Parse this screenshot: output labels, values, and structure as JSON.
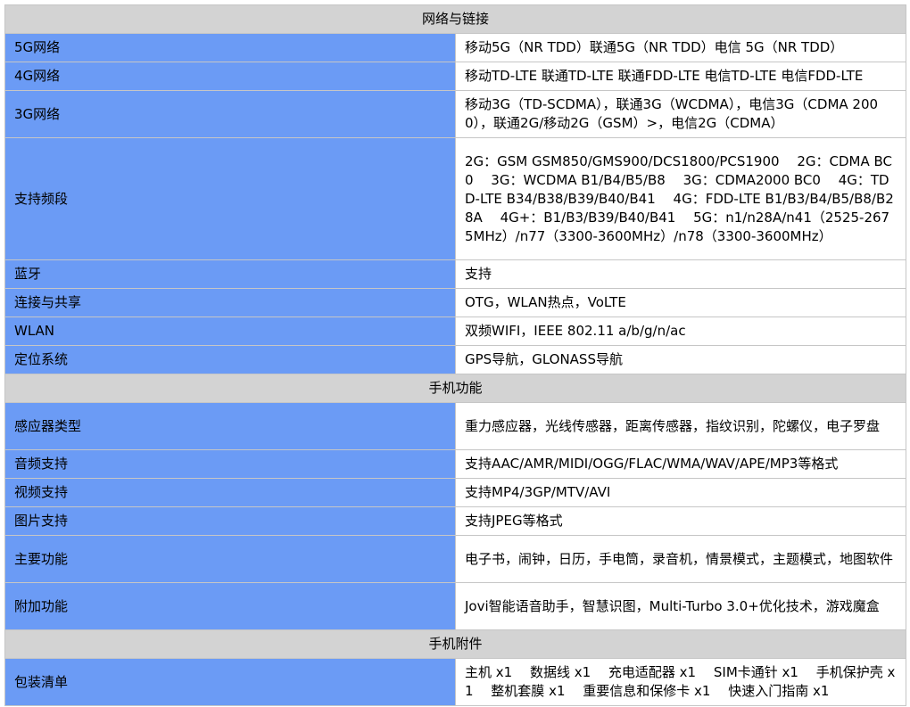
{
  "sections": [
    {
      "title": "网络与链接",
      "rows": [
        {
          "label": "5G网络",
          "value": "移动5G（NR TDD）联通5G（NR TDD）电信 5G（NR TDD）"
        },
        {
          "label": "4G网络",
          "value": "移动TD-LTE 联通TD-LTE 联通FDD-LTE 电信TD-LTE 电信FDD-LTE"
        },
        {
          "label": "3G网络",
          "value": "移动3G（TD-SCDMA），联通3G（WCDMA），电信3G（CDMA 2000），联通2G/移动2G（GSM）>，电信2G（CDMA）"
        },
        {
          "label": "支持频段",
          "value": "2G：GSM GSM850/GMS900/DCS1800/PCS1900　 2G：CDMA BC0　 3G：WCDMA B1/B4/B5/B8　 3G：CDMA2000 BC0　 4G：TDD-LTE B34/B38/B39/B40/B41　 4G：FDD-LTE B1/B3/B4/B5/B8/B28A　 4G+：B1/B3/B39/B40/B41　 5G：n1/n28A/n41（2525-2675MHz）/n77（3300-3600MHz）/n78（3300-3600MHz）"
        },
        {
          "label": "蓝牙",
          "value": "支持"
        },
        {
          "label": "连接与共享",
          "value": "OTG，WLAN热点，VoLTE"
        },
        {
          "label": "WLAN",
          "value": "双频WIFI，IEEE 802.11 a/b/g/n/ac"
        },
        {
          "label": "定位系统",
          "value": "GPS导航，GLONASS导航"
        }
      ]
    },
    {
      "title": "手机功能",
      "rows": [
        {
          "label": "感应器类型",
          "value": "重力感应器，光线传感器，距离传感器，指纹识别，陀螺仪，电子罗盘"
        },
        {
          "label": "音频支持",
          "value": "支持AAC/AMR/MIDI/OGG/FLAC/WMA/WAV/APE/MP3等格式"
        },
        {
          "label": "视频支持",
          "value": "支持MP4/3GP/MTV/AVI"
        },
        {
          "label": "图片支持",
          "value": "支持JPEG等格式"
        },
        {
          "label": "主要功能",
          "value": "电子书，闹钟，日历，手电筒，录音机，情景模式，主题模式，地图软件"
        },
        {
          "label": "附加功能",
          "value": "Jovi智能语音助手，智慧识图，Multi-Turbo 3.0+优化技术，游戏魔盒"
        }
      ]
    },
    {
      "title": "手机附件",
      "rows": [
        {
          "label": "包装清单",
          "value": "主机 x1　 数据线 x1　 充电适配器 x1　 SIM卡通针 x1　 手机保护壳 x1　 整机套膜 x1　 重要信息和保修卡 x1　 快速入门指南 x1"
        }
      ]
    }
  ]
}
